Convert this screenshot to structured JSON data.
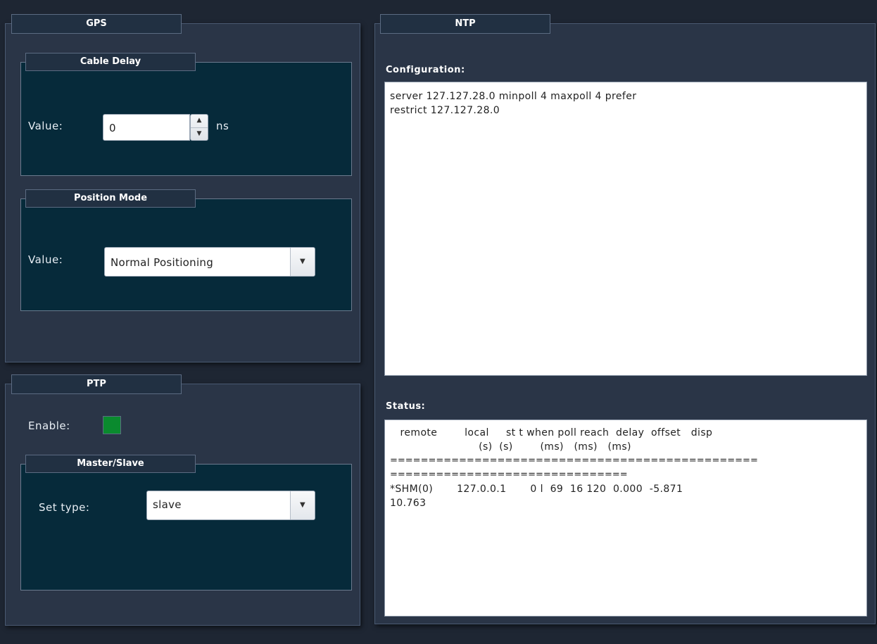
{
  "gps": {
    "title": "GPS",
    "cable_delay": {
      "title": "Cable Delay",
      "value_label": "Value:",
      "value": "0",
      "unit": "ns"
    },
    "position_mode": {
      "title": "Position Mode",
      "value_label": "Value:",
      "selected": "Normal Positioning"
    }
  },
  "ptp": {
    "title": "PTP",
    "enable_label": "Enable:",
    "enabled": true,
    "enabled_color": "#0a8a2e",
    "master_slave": {
      "title": "Master/Slave",
      "set_type_label": "Set type:",
      "selected": "slave"
    }
  },
  "ntp": {
    "title": "NTP",
    "configuration_label": "Configuration:",
    "configuration_lines": [
      "server 127.127.28.0 minpoll 4 maxpoll 4 prefer",
      "restrict 127.127.28.0"
    ],
    "status_label": "Status:",
    "status_lines": [
      "   remote        local     st t when poll reach  delay  offset   disp",
      "                          (s)  (s)        (ms)   (ms)   (ms)",
      "================================================",
      "===============================",
      "*SHM(0)       127.0.0.1       0 l  69  16 120  0.000  -5.871",
      "10.763"
    ]
  }
}
